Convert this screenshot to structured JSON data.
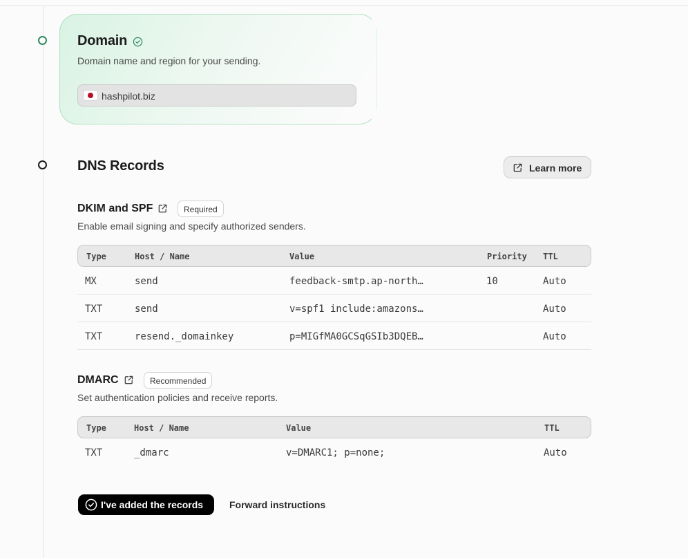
{
  "domain_step": {
    "title": "Domain",
    "description": "Domain name and region for your sending.",
    "domain_value": "hashpilot.biz",
    "region_flag": "japan-flag-icon"
  },
  "dns_step": {
    "title": "DNS Records",
    "learn_more_label": "Learn more",
    "dkim_spf": {
      "title": "DKIM and SPF",
      "badge": "Required",
      "description": "Enable email signing and specify authorized senders.",
      "headers": {
        "type": "Type",
        "host": "Host / Name",
        "value": "Value",
        "priority": "Priority",
        "ttl": "TTL"
      },
      "rows": [
        {
          "type": "MX",
          "host": "send",
          "value": "feedback-smtp.ap-north…",
          "priority": "10",
          "ttl": "Auto"
        },
        {
          "type": "TXT",
          "host": "send",
          "value": "v=spf1 include:amazons…",
          "priority": "",
          "ttl": "Auto"
        },
        {
          "type": "TXT",
          "host": "resend._domainkey",
          "value": "p=MIGfMA0GCSqGSIb3DQEB…",
          "priority": "",
          "ttl": "Auto"
        }
      ]
    },
    "dmarc": {
      "title": "DMARC",
      "badge": "Recommended",
      "description": "Set authentication policies and receive reports.",
      "headers": {
        "type": "Type",
        "host": "Host / Name",
        "value": "Value",
        "ttl": "TTL"
      },
      "rows": [
        {
          "type": "TXT",
          "host": "_dmarc",
          "value": "v=DMARC1; p=none;",
          "ttl": "Auto"
        }
      ]
    }
  },
  "actions": {
    "primary_label": "I've added the records",
    "secondary_label": "Forward instructions"
  },
  "colors": {
    "accent_green": "#2f8a5f",
    "primary_button": "#000000"
  }
}
